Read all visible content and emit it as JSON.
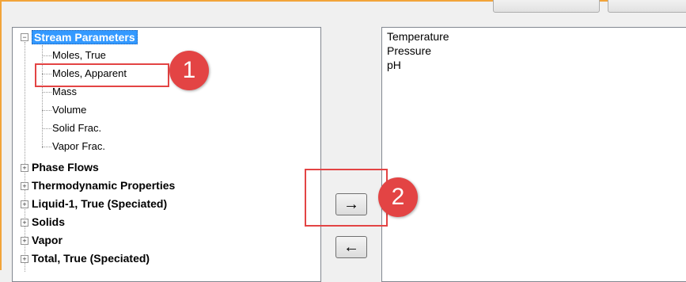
{
  "tree": {
    "root": {
      "label": "Stream Parameters",
      "expander": "−"
    },
    "children": [
      "Moles, True",
      "Moles, Apparent",
      "Mass",
      "Volume",
      "Solid Frac.",
      "Vapor Frac."
    ],
    "collapsed": [
      "Phase Flows",
      "Thermodynamic Properties",
      "Liquid-1, True (Speciated)",
      "Solids",
      "Vapor",
      "Total, True (Speciated)"
    ],
    "collapsed_expander": "+"
  },
  "selected_list": {
    "items": [
      "Temperature",
      "Pressure",
      "pH"
    ]
  },
  "buttons": {
    "add_arrow": "→",
    "remove_arrow": "←"
  },
  "callouts": [
    {
      "number": "1",
      "color": "#e34444"
    },
    {
      "number": "2",
      "color": "#e34444"
    }
  ]
}
